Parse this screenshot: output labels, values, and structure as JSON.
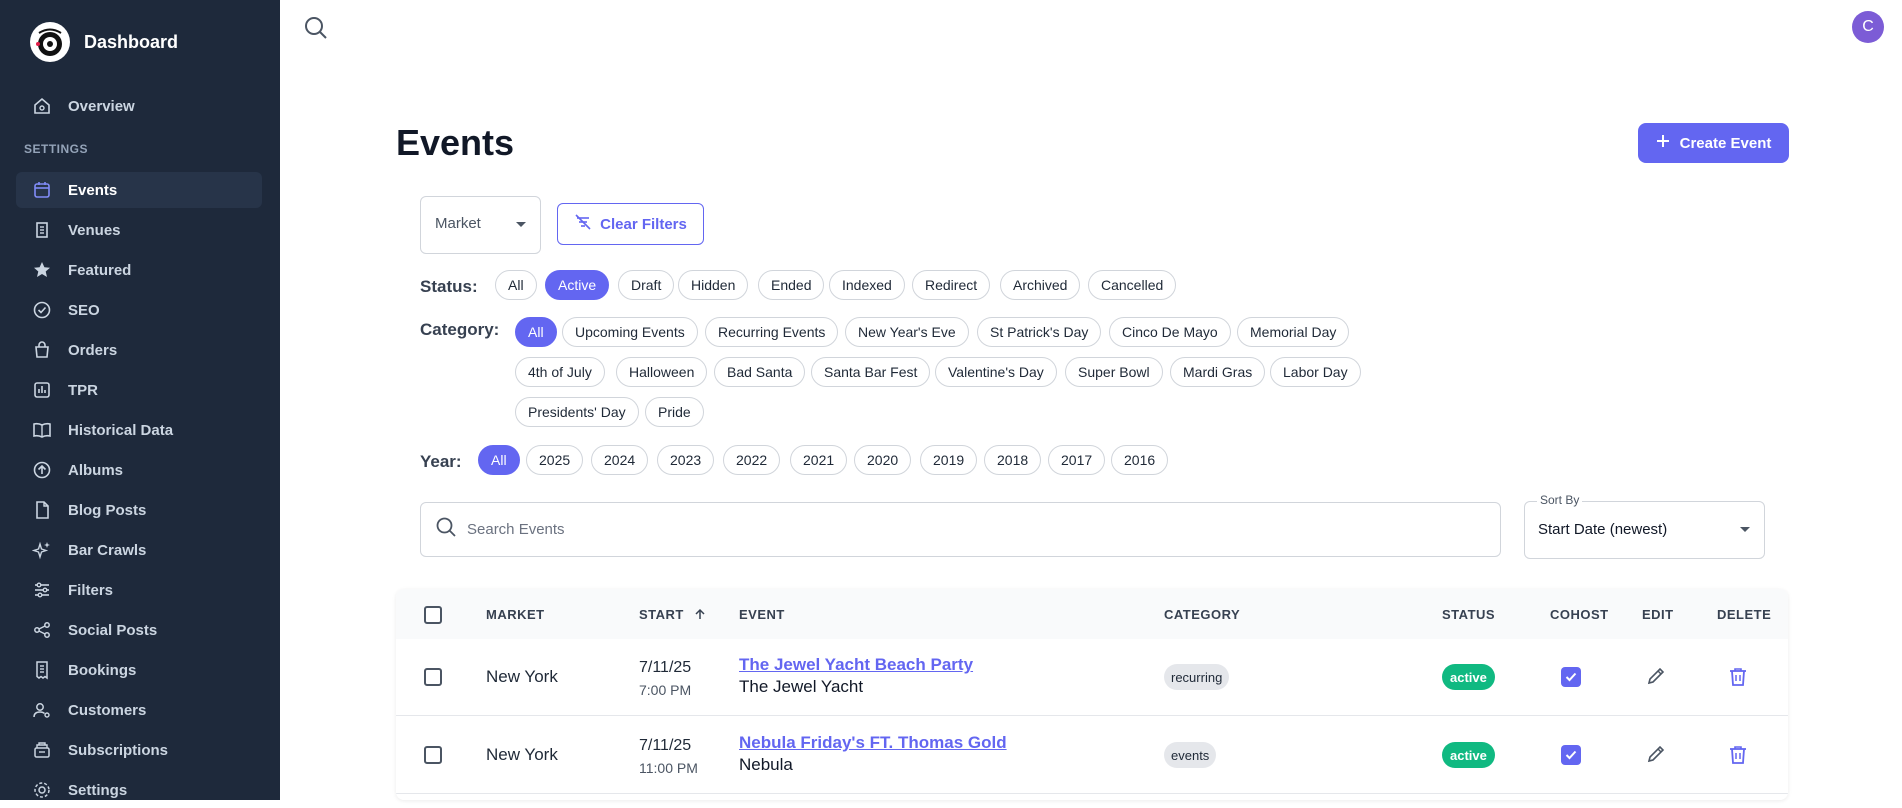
{
  "brand": {
    "title": "Dashboard"
  },
  "sidebar": {
    "overview": "Overview",
    "section_label": "SETTINGS",
    "items": [
      {
        "label": "Events",
        "icon": "calendar-icon",
        "active": true
      },
      {
        "label": "Venues",
        "icon": "building-icon"
      },
      {
        "label": "Featured",
        "icon": "star-icon"
      },
      {
        "label": "SEO",
        "icon": "check-circle-icon"
      },
      {
        "label": "Orders",
        "icon": "shopping-bag-icon"
      },
      {
        "label": "TPR",
        "icon": "chart-bar-icon"
      },
      {
        "label": "Historical Data",
        "icon": "book-icon"
      },
      {
        "label": "Albums",
        "icon": "upload-circle-icon"
      },
      {
        "label": "Blog Posts",
        "icon": "document-icon"
      },
      {
        "label": "Bar Crawls",
        "icon": "sparkles-icon"
      },
      {
        "label": "Filters",
        "icon": "sliders-icon"
      },
      {
        "label": "Social Posts",
        "icon": "share-icon"
      },
      {
        "label": "Bookings",
        "icon": "receipt-icon"
      },
      {
        "label": "Customers",
        "icon": "user-gear-icon"
      },
      {
        "label": "Subscriptions",
        "icon": "inbox-stack-icon"
      },
      {
        "label": "Settings",
        "icon": "gear-icon"
      }
    ]
  },
  "header": {
    "avatar_initial": "C"
  },
  "page": {
    "title": "Events",
    "create_button": "Create Event",
    "market_select": "Market",
    "clear_filters": "Clear Filters"
  },
  "filters": {
    "status_label": "Status:",
    "status": [
      "All",
      "Active",
      "Draft",
      "Hidden",
      "Ended",
      "Indexed",
      "Redirect",
      "Archived",
      "Cancelled"
    ],
    "status_selected": "Active",
    "category_label": "Category:",
    "category": [
      "All",
      "Upcoming Events",
      "Recurring Events",
      "New Year's Eve",
      "St Patrick's Day",
      "Cinco De Mayo",
      "Memorial Day",
      "4th of July",
      "Halloween",
      "Bad Santa",
      "Santa Bar Fest",
      "Valentine's Day",
      "Super Bowl",
      "Mardi Gras",
      "Labor Day",
      "Presidents' Day",
      "Pride"
    ],
    "category_selected": "All",
    "year_label": "Year:",
    "year": [
      "All",
      "2025",
      "2024",
      "2023",
      "2022",
      "2021",
      "2020",
      "2019",
      "2018",
      "2017",
      "2016"
    ],
    "year_selected": "All"
  },
  "search": {
    "placeholder": "Search Events"
  },
  "sort": {
    "label": "Sort By",
    "value": "Start Date (newest)"
  },
  "table": {
    "columns": {
      "market": "MARKET",
      "start": "START",
      "event": "EVENT",
      "category": "CATEGORY",
      "status": "STATUS",
      "cohost": "COHOST",
      "edit": "EDIT",
      "delete": "DELETE"
    },
    "rows": [
      {
        "market": "New York",
        "date": "7/11/25",
        "time": "7:00 PM",
        "event": "The Jewel Yacht Beach Party",
        "venue": "The Jewel Yacht",
        "category": "recurring",
        "status": "active",
        "cohost": true
      },
      {
        "market": "New York",
        "date": "7/11/25",
        "time": "11:00 PM",
        "event": "Nebula Friday's FT. Thomas Gold",
        "venue": "Nebula",
        "category": "events",
        "status": "active",
        "cohost": true
      }
    ]
  },
  "colors": {
    "sidebar_bg": "#1e293b",
    "accent": "#6366f1",
    "status_active": "#10b981"
  }
}
